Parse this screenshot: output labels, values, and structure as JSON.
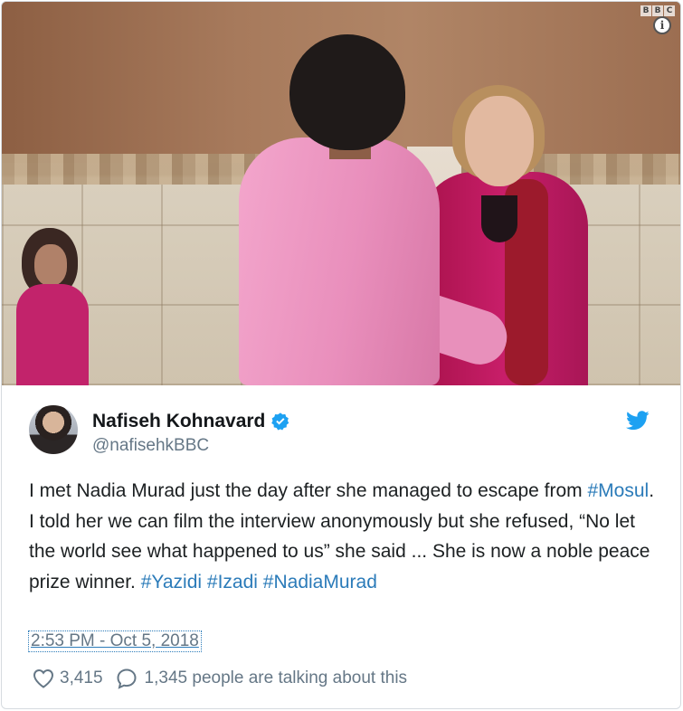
{
  "media": {
    "watermark": [
      "B",
      "B",
      "C"
    ],
    "info_symbol": "i"
  },
  "author": {
    "display_name": "Nafiseh Kohnavard",
    "handle": "@nafisehkBBC",
    "verified": true,
    "avatar_icon": "avatar",
    "platform_icon": "twitter-bird-icon"
  },
  "tweet": {
    "text_parts": [
      {
        "text": "I met Nadia Murad just the day after she managed to escape from "
      },
      {
        "text": "#Mosul",
        "hashtag": true
      },
      {
        "text": ". I told her we can film the interview anonymously but she refused, “No let the world see what happened to us” she said ... She is now a noble peace prize winner. "
      },
      {
        "text": "#Yazidi",
        "hashtag": true
      },
      {
        "text": " "
      },
      {
        "text": "#Izadi",
        "hashtag": true
      },
      {
        "text": " "
      },
      {
        "text": "#NadiaMurad",
        "hashtag": true
      }
    ],
    "timestamp": "2:53 PM - Oct 5, 2018"
  },
  "actions": {
    "likes": "3,415",
    "talking": "1,345 people are talking about this"
  },
  "colors": {
    "link": "#2b7bb9",
    "verified": "#1da1f2",
    "muted": "#657786"
  }
}
